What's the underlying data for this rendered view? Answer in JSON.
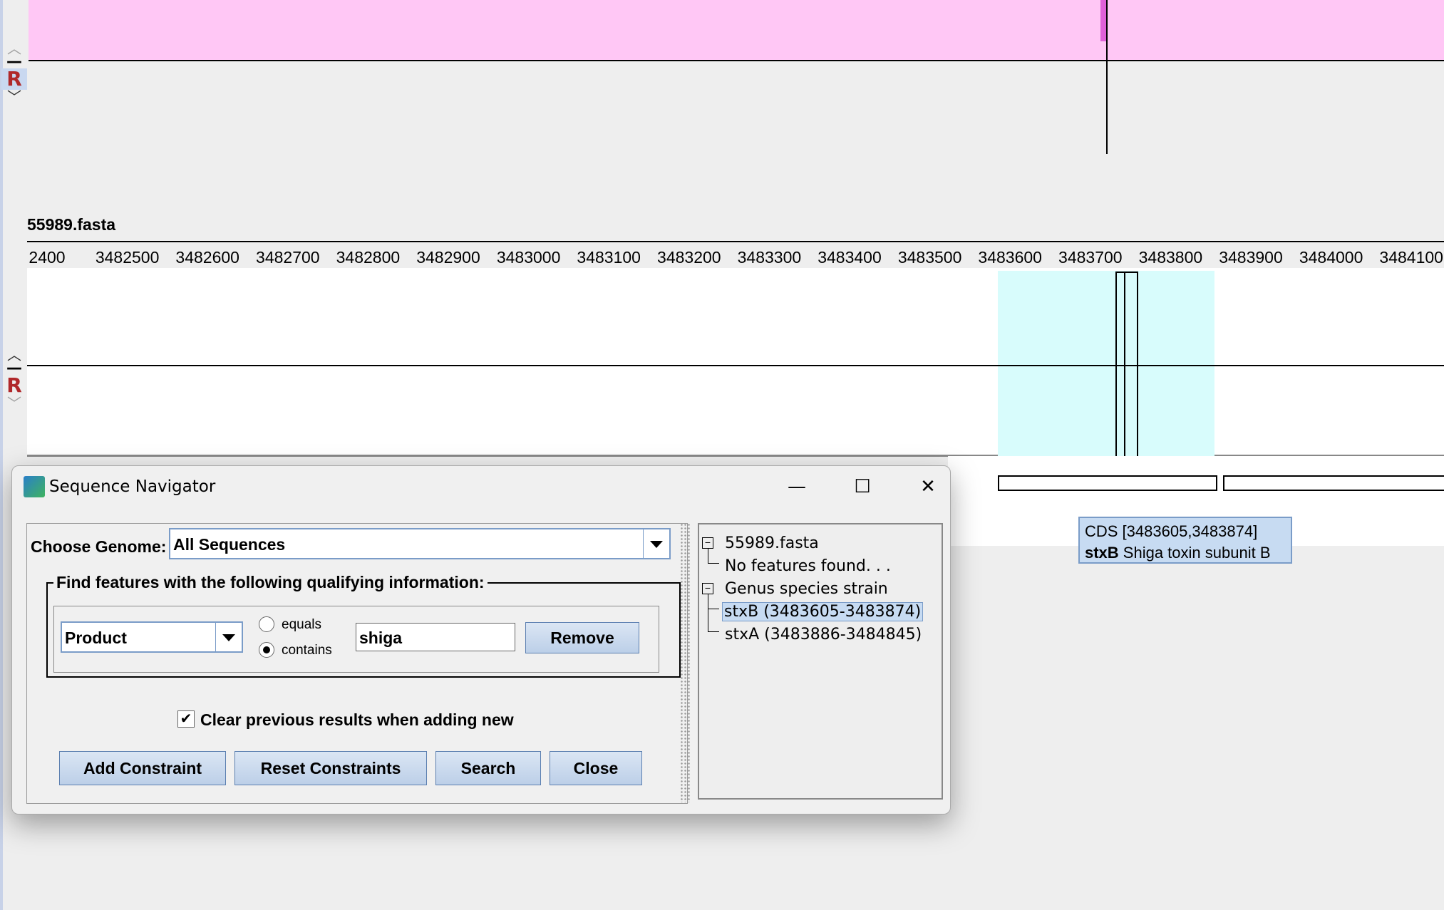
{
  "track_controls": {
    "up_icon": "chevron-up-icon",
    "collapse_label": "—",
    "reverse_label": "R",
    "down_icon": "chevron-down-icon"
  },
  "sequence": {
    "file_label": "55989.fasta",
    "ruler_ticks": [
      "2400",
      "3482500",
      "3482600",
      "3482700",
      "3482800",
      "3482900",
      "3483000",
      "3483100",
      "3483200",
      "3483300",
      "3483400",
      "3483500",
      "3483600",
      "3483700",
      "3483800",
      "3483900",
      "3484000",
      "3484100"
    ]
  },
  "tooltip": {
    "line1": "CDS [3483605,3483874]",
    "gene": "stxB",
    "product": " Shiga toxin subunit B"
  },
  "dialog": {
    "title": "Sequence Navigator",
    "minimize": "—",
    "maximize": "☐",
    "close": "✕",
    "choose_genome_label": "Choose Genome:",
    "genome_value": "All Sequences",
    "group_title": "Find features with the following qualifying information:",
    "field_value": "Product",
    "equals_label": "equals",
    "contains_label": "contains",
    "match_mode": "contains",
    "search_text": "shiga",
    "remove_button": "Remove",
    "clear_checkbox_label": "Clear previous results when adding new",
    "clear_checked": true,
    "checkmark": "✔",
    "buttons": {
      "add_constraint": "Add Constraint",
      "reset_constraints": "Reset Constraints",
      "search": "Search",
      "close": "Close"
    },
    "tree": {
      "toggle_symbol": "−",
      "node1": "55989.fasta",
      "node1_child": "No features found. . .",
      "node2": "Genus species strain",
      "node2_children": [
        "stxB (3483605-3483874)",
        "stxA (3483886-3484845)"
      ]
    }
  }
}
